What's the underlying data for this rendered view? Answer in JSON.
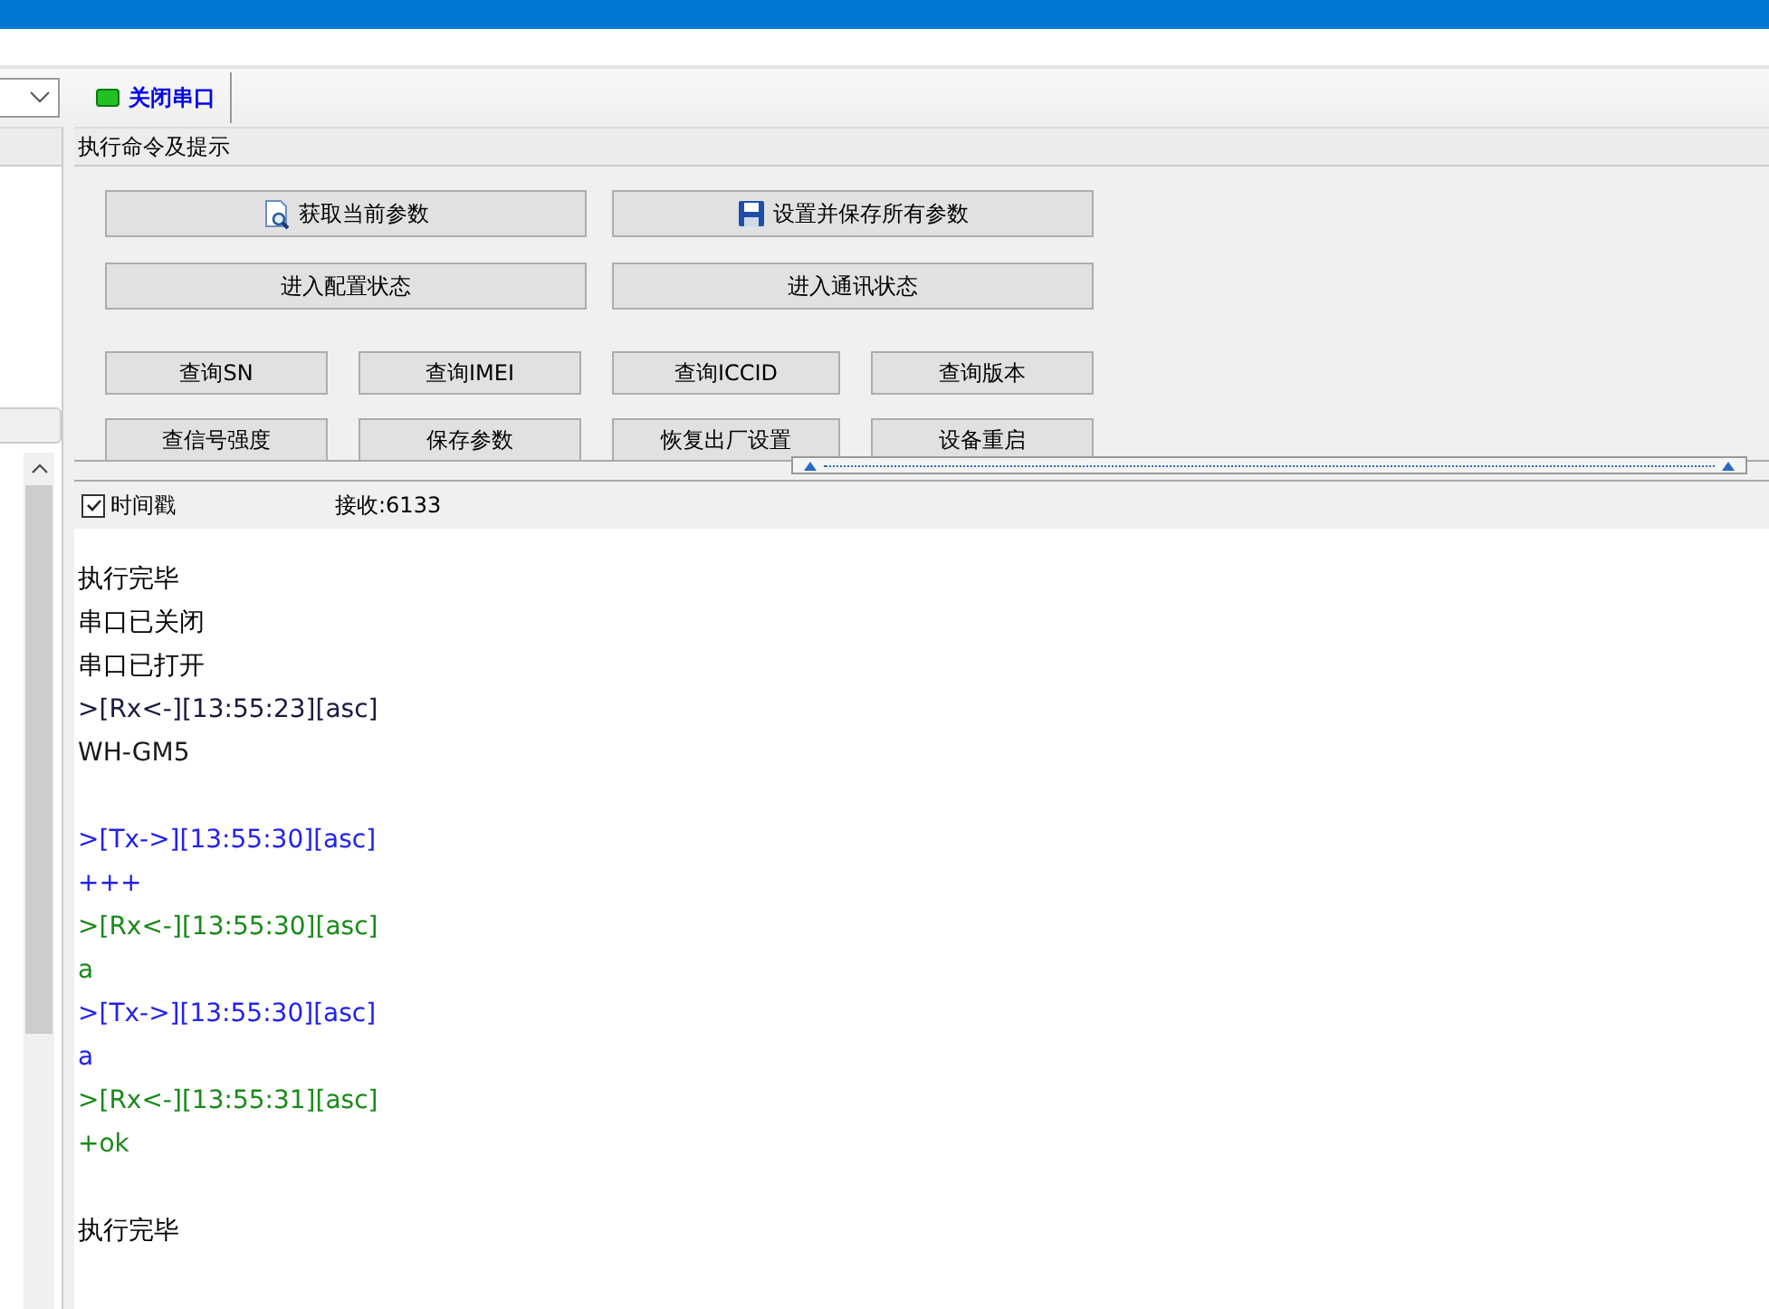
{
  "toolbar": {
    "port_button": {
      "label": "关闭串口",
      "open": true
    }
  },
  "panel": {
    "title": "执行命令及提示"
  },
  "wide_buttons": [
    {
      "label": "获取当前参数"
    },
    {
      "label": "设置并保存所有参数"
    },
    {
      "label": "进入配置状态"
    },
    {
      "label": "进入通讯状态"
    }
  ],
  "small_buttons": [
    "查询SN",
    "查询IMEI",
    "查询ICCID",
    "查询版本",
    "查信号强度",
    "保存参数",
    "恢复出厂设置",
    "设备重启"
  ],
  "timestamp": {
    "label": "时间戳",
    "checked": true
  },
  "received": "接收:6133",
  "log": [
    [
      {
        "text": "执行完毕",
        "color": "#000000"
      },
      {
        "text": "串口已关闭",
        "color": "#000000"
      },
      {
        "text": "串口已打开",
        "color": "#000000"
      },
      {
        "text": ">[Rx<-][13:55:23][asc]",
        "color": "#1a1a40"
      },
      {
        "text": "WH-GM5",
        "color": "#1a1a1a"
      }
    ],
    [
      {
        "text": ">[Tx->][13:55:30][asc]",
        "color": "#2222ee"
      },
      {
        "text": "+++",
        "color": "#2222ee"
      },
      {
        "text": ">[Rx<-][13:55:30][asc]",
        "color": "#1a8a1a"
      },
      {
        "text": "a",
        "color": "#1a8a1a"
      },
      {
        "text": ">[Tx->][13:55:30][asc]",
        "color": "#2222ee"
      },
      {
        "text": "a",
        "color": "#2222ee"
      },
      {
        "text": ">[Rx<-][13:55:31][asc]",
        "color": "#1a8a1a"
      },
      {
        "text": "+ok",
        "color": "#1a8a1a"
      }
    ],
    [
      {
        "text": "执行完毕",
        "color": "#000000"
      }
    ]
  ]
}
